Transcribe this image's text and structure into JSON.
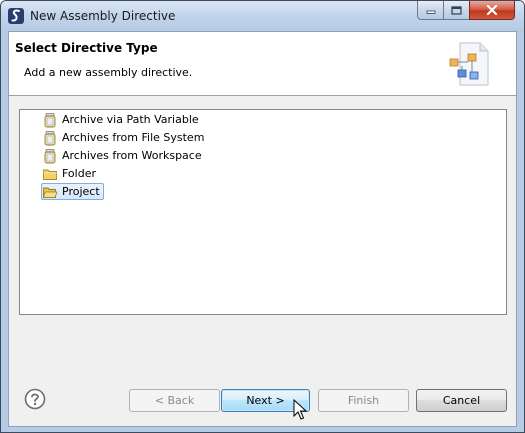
{
  "window": {
    "title": "New Assembly Directive",
    "controls": [
      "minimize-icon",
      "maximize-icon",
      "close-icon"
    ]
  },
  "header": {
    "title": "Select Directive Type",
    "description": "Add a new assembly directive."
  },
  "tree": {
    "items": [
      {
        "label": "Archive via Path Variable",
        "icon": "archive-jar-icon",
        "selected": false
      },
      {
        "label": "Archives from File System",
        "icon": "archive-jar-icon",
        "selected": false
      },
      {
        "label": "Archives from Workspace",
        "icon": "archive-jar-icon",
        "selected": false
      },
      {
        "label": "Folder",
        "icon": "folder-icon",
        "selected": false
      },
      {
        "label": "Project",
        "icon": "project-folder-icon",
        "selected": true
      }
    ]
  },
  "buttons": {
    "back": "< Back",
    "next": "Next >",
    "finish": "Finish",
    "cancel": "Cancel"
  },
  "colors": {
    "titlebar": "#c2d4ea",
    "selection": "#d6e8fb",
    "default_button": "#bee6fd",
    "close_button": "#c2361f"
  }
}
